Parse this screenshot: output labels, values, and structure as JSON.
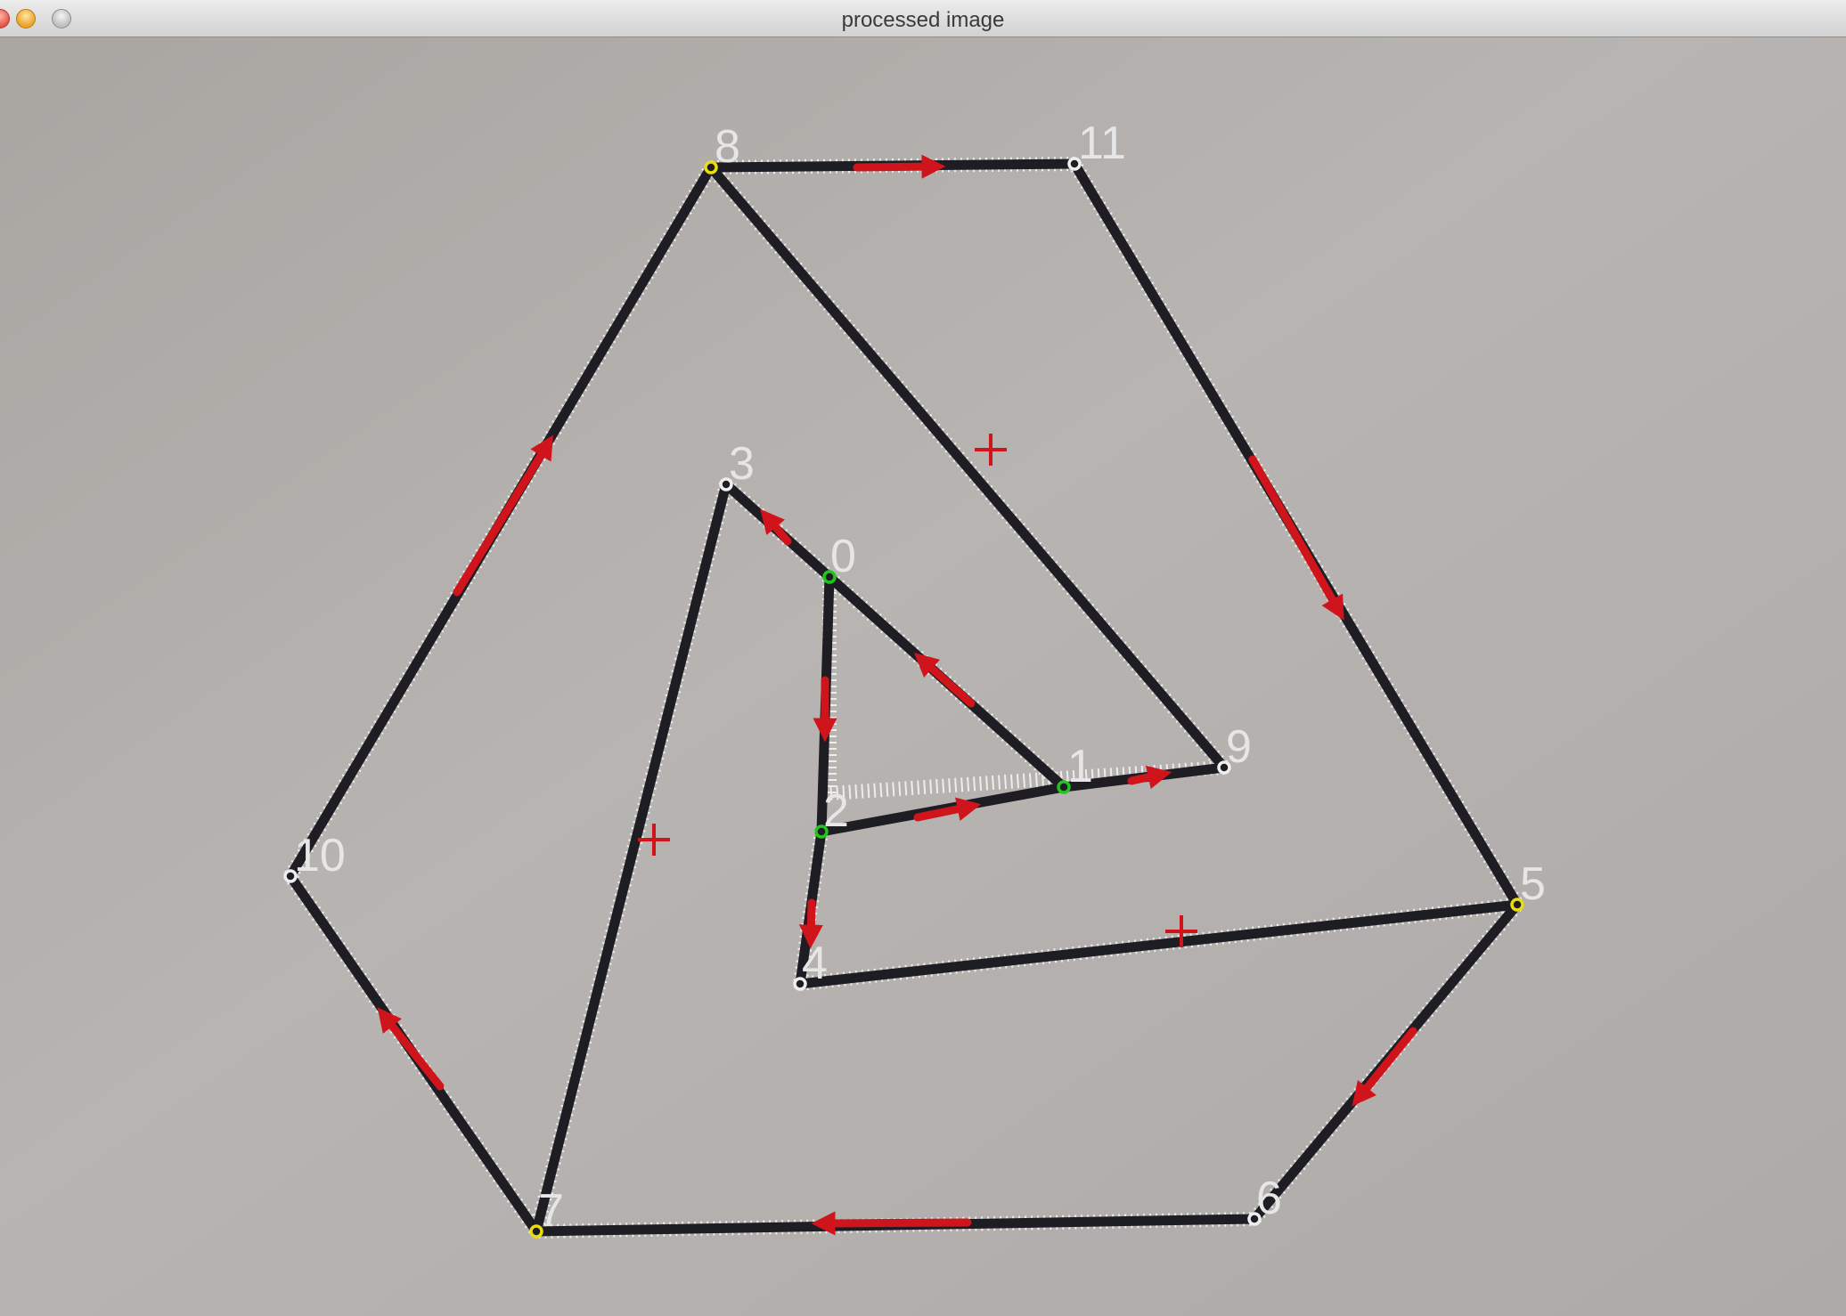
{
  "window": {
    "title": "processed image"
  },
  "labels": {
    "p0": "0",
    "p1": "1",
    "p2": "2",
    "p3": "3",
    "p4": "4",
    "p5": "5",
    "p6": "6",
    "p7": "7",
    "p8": "8",
    "p9": "9",
    "p10": "10",
    "p11": "11"
  },
  "colors": {
    "stroke": "#1e1d24",
    "arrow": "#d0141c",
    "point_green": "#22c41e",
    "point_yellow": "#e8dc12",
    "point_white": "#eeeeee",
    "label": "#e6e6e6"
  }
}
